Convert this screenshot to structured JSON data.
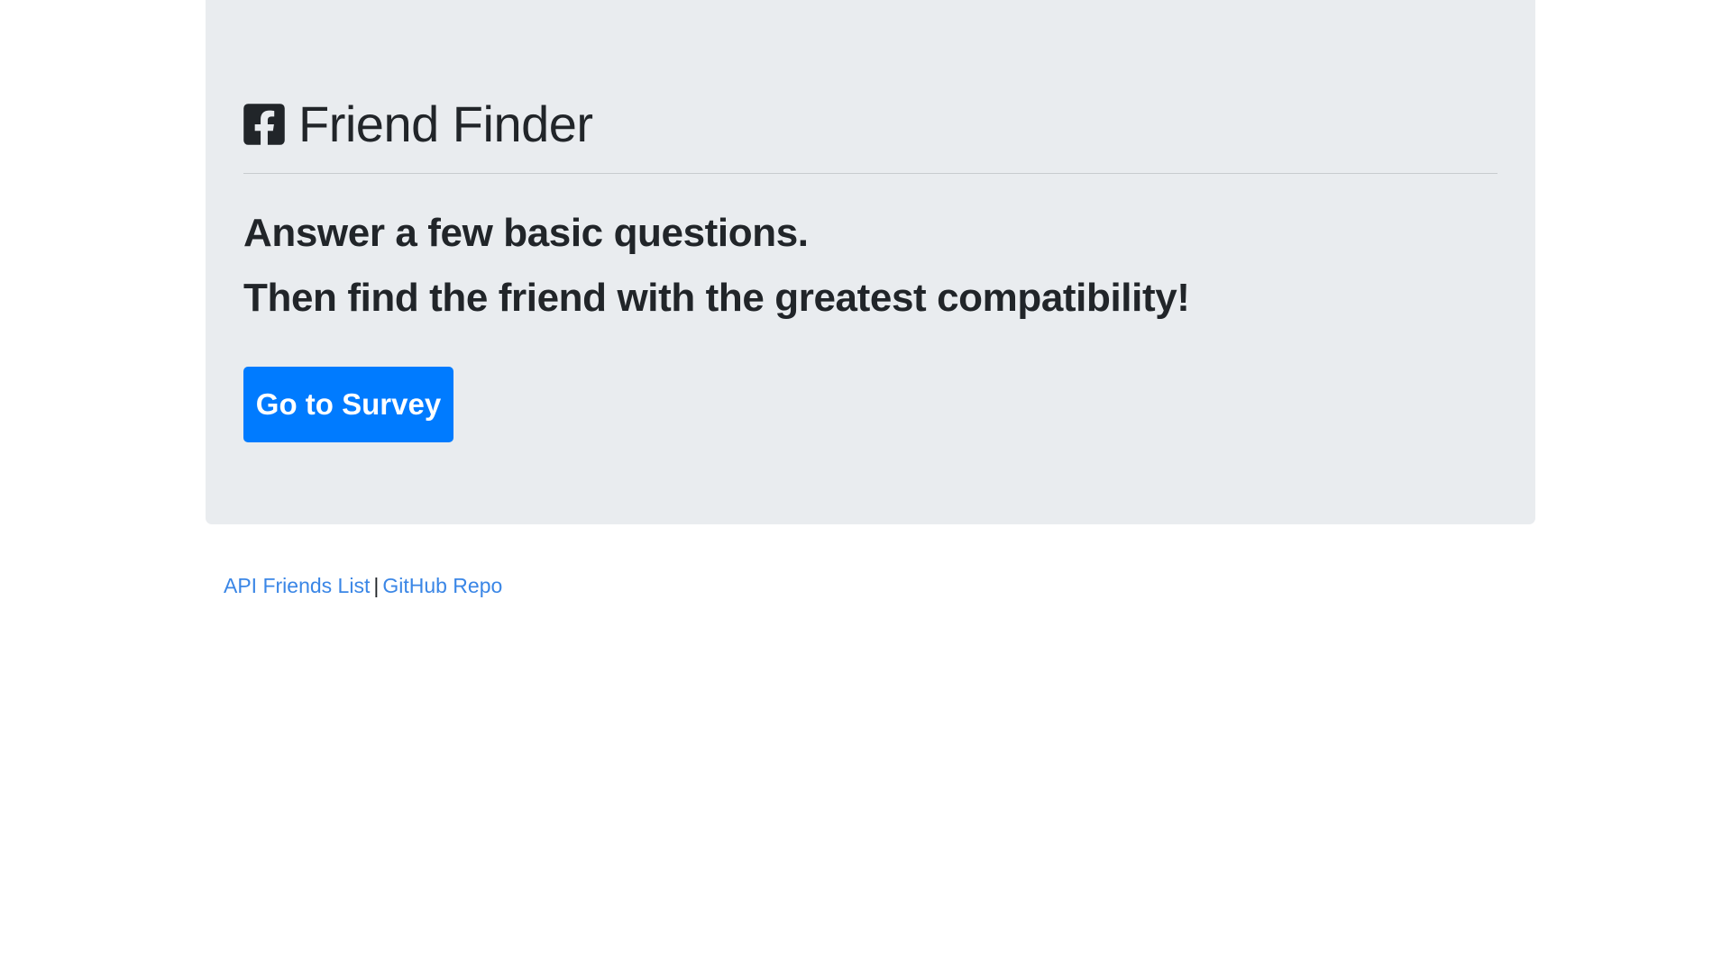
{
  "header": {
    "icon": "facebook-square-icon",
    "title": "Friend Finder"
  },
  "lead": {
    "line1": "Answer a few basic questions.",
    "line2": "Then find the friend with the greatest compatibility!"
  },
  "cta": {
    "label": "Go to Survey"
  },
  "footer": {
    "api_link": "API Friends List",
    "separator": "|",
    "github_link": "GitHub Repo"
  },
  "colors": {
    "jumbotron_bg": "#e9ecef",
    "primary": "#007bff",
    "link": "#3a86e6",
    "text": "#212529"
  }
}
